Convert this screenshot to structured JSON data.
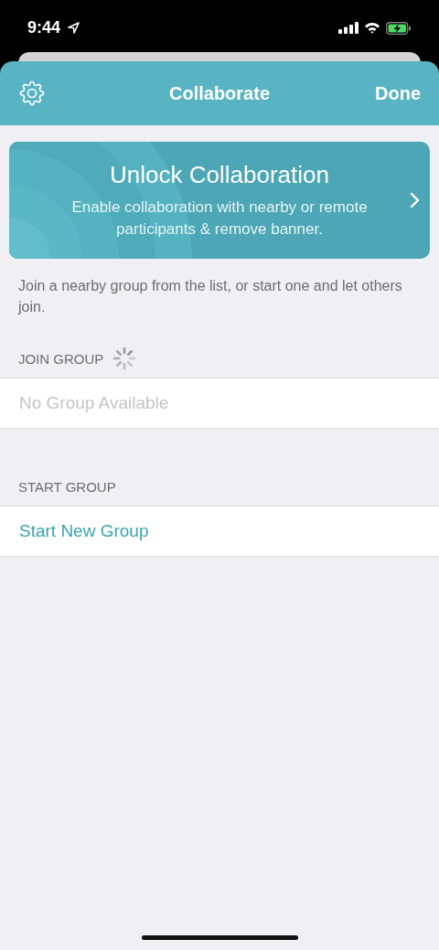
{
  "status_bar": {
    "time": "9:44"
  },
  "nav_bar": {
    "title": "Collaborate",
    "done": "Done"
  },
  "banner": {
    "title": "Unlock Collaboration",
    "text": "Enable collaboration with nearby or remote participants & remove banner."
  },
  "description": "Join a nearby group from the list, or start one and let others join.",
  "sections": [
    {
      "header": "JOIN GROUP",
      "loading": true,
      "rows": [
        {
          "label": "No Group Available",
          "kind": "placeholder"
        }
      ]
    },
    {
      "header": "START GROUP",
      "rows": [
        {
          "label": "Start New Group",
          "kind": "action"
        }
      ]
    }
  ]
}
